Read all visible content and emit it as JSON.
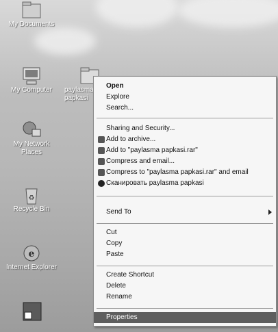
{
  "desktop": {
    "icons": [
      {
        "label": "My Documents",
        "icon": "folder-icon"
      },
      {
        "label": "My Computer",
        "icon": "computer-icon"
      },
      {
        "label": "paylasma papkasi",
        "icon": "folder-icon"
      },
      {
        "label": "My Network Places",
        "icon": "network-icon"
      },
      {
        "label": "Recycle Bin",
        "icon": "recycle-bin-icon"
      },
      {
        "label": "Internet Explorer",
        "icon": "ie-icon"
      }
    ]
  },
  "context_menu": {
    "items": [
      {
        "label": "Open",
        "bold": true
      },
      {
        "label": "Explore"
      },
      {
        "label": "Search..."
      },
      {
        "separator": true
      },
      {
        "label": "Sharing and Security..."
      },
      {
        "label": "Add to archive...",
        "icon": "archive-icon"
      },
      {
        "label": "Add to \"paylasma papkasi.rar\"",
        "icon": "archive-icon"
      },
      {
        "label": "Compress and email...",
        "icon": "archive-icon"
      },
      {
        "label": "Compress to \"paylasma papkasi.rar\" and email",
        "icon": "archive-icon"
      },
      {
        "label": "Сканировать paylasma papkasi",
        "icon": "antivirus-icon"
      },
      {
        "separator": true
      },
      {
        "label": "Send To",
        "submenu": true
      },
      {
        "separator": true
      },
      {
        "label": "Cut"
      },
      {
        "label": "Copy"
      },
      {
        "label": "Paste"
      },
      {
        "separator": true
      },
      {
        "label": "Create Shortcut"
      },
      {
        "label": "Delete"
      },
      {
        "label": "Rename"
      },
      {
        "separator": true
      },
      {
        "label": "Properties",
        "selected": true
      }
    ]
  }
}
